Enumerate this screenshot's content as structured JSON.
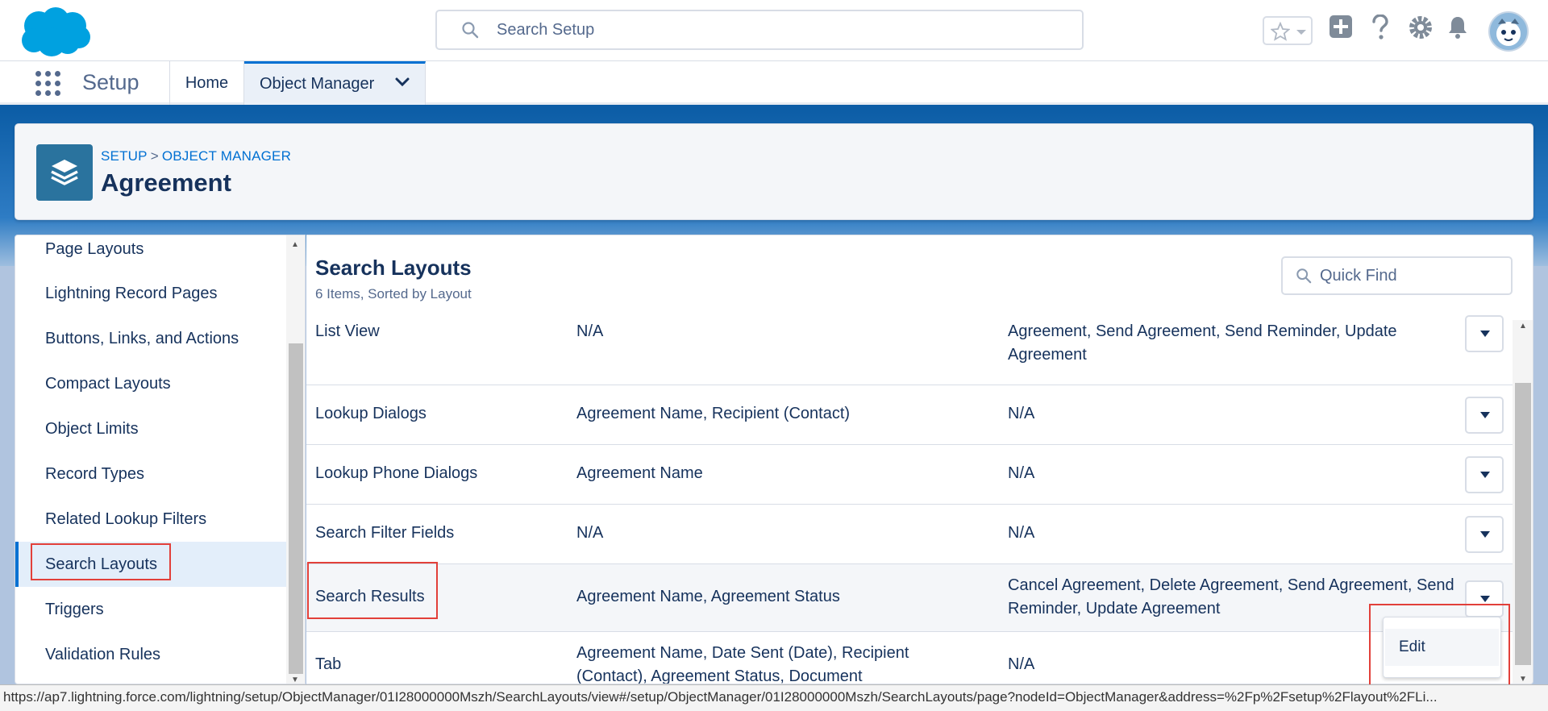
{
  "header": {
    "search_placeholder": "Search Setup",
    "icons": [
      "salesforce-logo",
      "star-icon",
      "plus-icon",
      "help-icon",
      "gear-icon",
      "bell-icon",
      "avatar"
    ]
  },
  "nav": {
    "app_name": "Setup",
    "tabs": [
      {
        "label": "Home"
      },
      {
        "label": "Object Manager",
        "active": true
      }
    ]
  },
  "page_header": {
    "breadcrumb": [
      "SETUP",
      "OBJECT MANAGER"
    ],
    "breadcrumb_sep": ">",
    "title": "Agreement"
  },
  "sidebar": {
    "items": [
      {
        "label": "Page Layouts"
      },
      {
        "label": "Lightning Record Pages"
      },
      {
        "label": "Buttons, Links, and Actions"
      },
      {
        "label": "Compact Layouts"
      },
      {
        "label": "Object Limits"
      },
      {
        "label": "Record Types"
      },
      {
        "label": "Related Lookup Filters"
      },
      {
        "label": "Search Layouts",
        "active": true
      },
      {
        "label": "Triggers"
      },
      {
        "label": "Validation Rules"
      }
    ]
  },
  "main": {
    "title": "Search Layouts",
    "subtitle": "6 Items, Sorted by Layout",
    "quick_find_placeholder": "Quick Find",
    "rows": [
      {
        "layout": "List View",
        "fields": "N/A",
        "buttons": "Agreement, Send Agreement, Send Reminder, Update Agreement"
      },
      {
        "layout": "Lookup Dialogs",
        "fields": "Agreement Name, Recipient (Contact)",
        "buttons": "N/A"
      },
      {
        "layout": "Lookup Phone Dialogs",
        "fields": "Agreement Name",
        "buttons": "N/A"
      },
      {
        "layout": "Search Filter Fields",
        "fields": "N/A",
        "buttons": "N/A"
      },
      {
        "layout": "Search Results",
        "fields": "Agreement Name, Agreement Status",
        "buttons": "Cancel Agreement, Delete Agreement, Send Agreement, Send Reminder, Update Agreement",
        "highlighted": true
      },
      {
        "layout": "Tab",
        "fields": "Agreement Name, Date Sent (Date), Recipient (Contact), Agreement Status, Document",
        "buttons": "N/A"
      }
    ],
    "row_menu": {
      "items": [
        {
          "label": "Edit"
        }
      ]
    }
  },
  "status_bar": {
    "url": "https://ap7.lightning.force.com/lightning/setup/ObjectManager/01I28000000Mszh/SearchLayouts/view#/setup/ObjectManager/01I28000000Mszh/SearchLayouts/page?nodeId=ObjectManager&address=%2Fp%2Fsetup%2Flayout%2FLi..."
  },
  "colors": {
    "brand_blue": "#0070d2",
    "text_dark": "#16325c",
    "text_muted": "#54698d",
    "object_icon": "#2a739e",
    "annotation_red": "#e2403a"
  }
}
